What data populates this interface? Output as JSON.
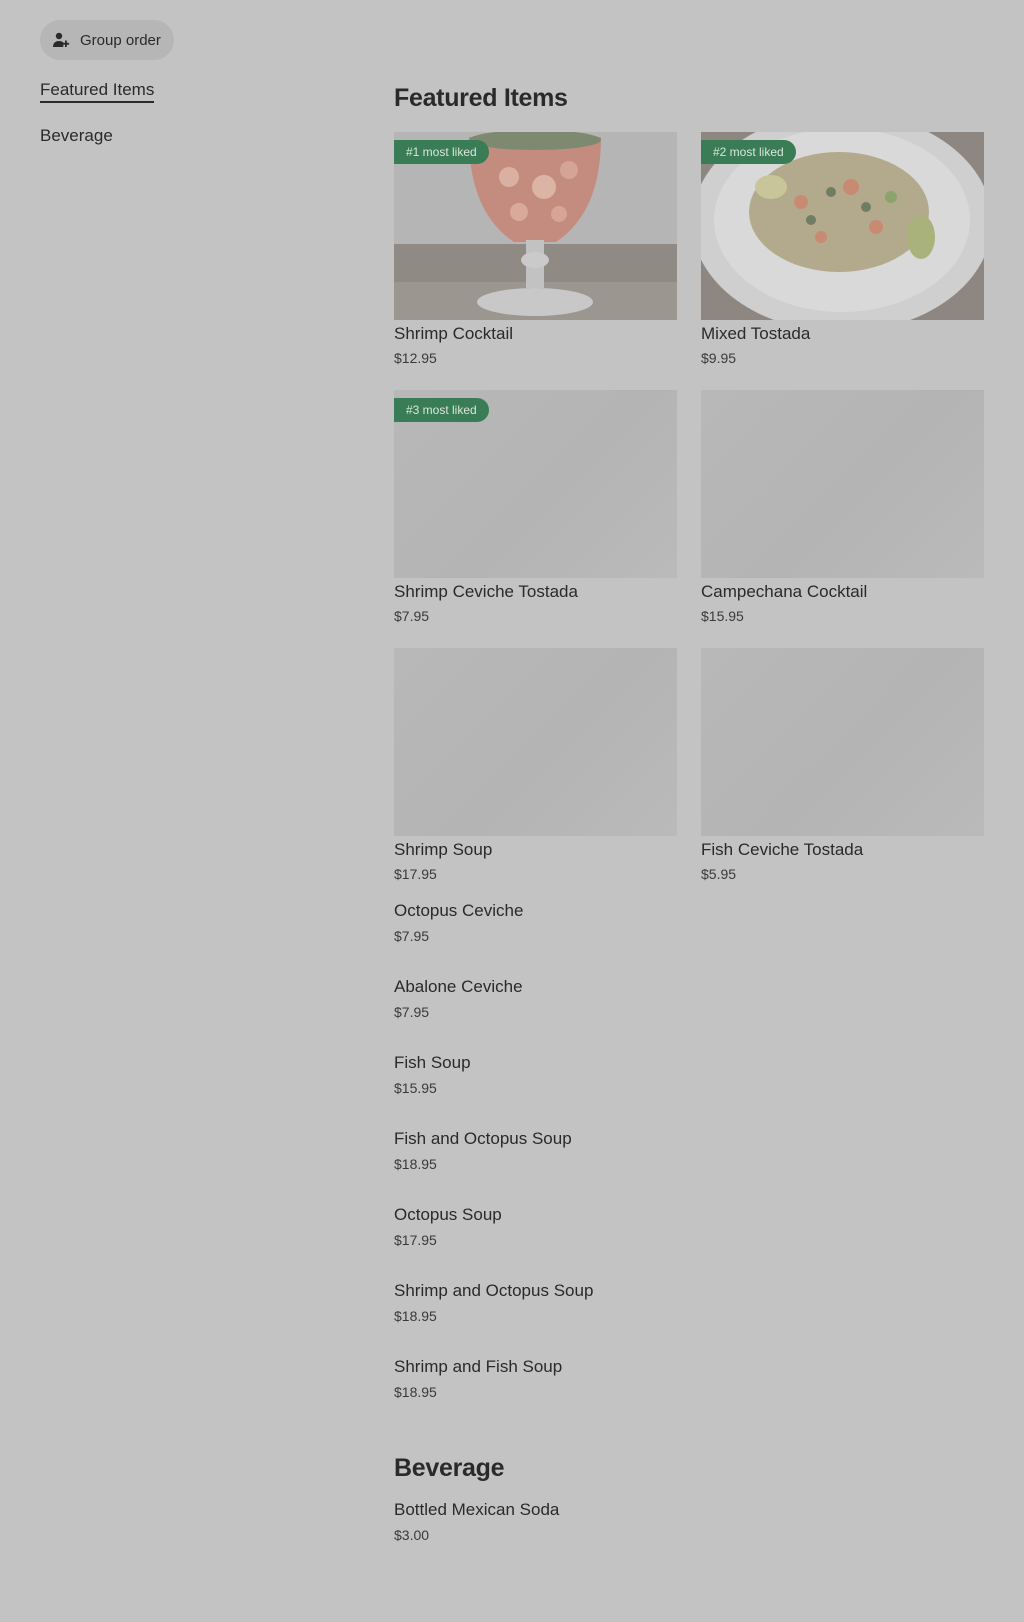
{
  "group_order": {
    "label": "Group order",
    "icon": "person-add-icon"
  },
  "sidebar": {
    "items": [
      {
        "label": "Featured Items",
        "active": true
      },
      {
        "label": "Beverage",
        "active": false
      }
    ]
  },
  "featured": {
    "title": "Featured Items",
    "cards": [
      {
        "name": "Shrimp Cocktail",
        "price": "$12.95",
        "badge": "#1 most liked",
        "image": "shrimp-cocktail-photo"
      },
      {
        "name": "Mixed Tostada",
        "price": "$9.95",
        "badge": "#2 most liked",
        "image": "mixed-tostada-photo"
      },
      {
        "name": "Shrimp Ceviche Tostada",
        "price": "$7.95",
        "badge": "#3 most liked",
        "image": ""
      },
      {
        "name": "Campechana Cocktail",
        "price": "$15.95",
        "badge": "",
        "image": ""
      },
      {
        "name": "Shrimp Soup",
        "price": "$17.95",
        "badge": "",
        "image": ""
      },
      {
        "name": "Fish Ceviche Tostada",
        "price": "$5.95",
        "badge": "",
        "image": ""
      }
    ],
    "list": [
      {
        "name": "Octopus Ceviche",
        "price": "$7.95"
      },
      {
        "name": "Abalone Ceviche",
        "price": "$7.95"
      },
      {
        "name": "Fish Soup",
        "price": "$15.95"
      },
      {
        "name": "Fish and Octopus Soup",
        "price": "$18.95"
      },
      {
        "name": "Octopus Soup",
        "price": "$17.95"
      },
      {
        "name": "Shrimp and Octopus Soup",
        "price": "$18.95"
      },
      {
        "name": "Shrimp and Fish Soup",
        "price": "$18.95"
      }
    ]
  },
  "beverage": {
    "title": "Beverage",
    "list": [
      {
        "name": "Bottled Mexican Soda",
        "price": "$3.00"
      }
    ]
  },
  "colors": {
    "background": "#c3c3c3",
    "badge": "#3a7c55",
    "text": "#2a2a2a"
  }
}
